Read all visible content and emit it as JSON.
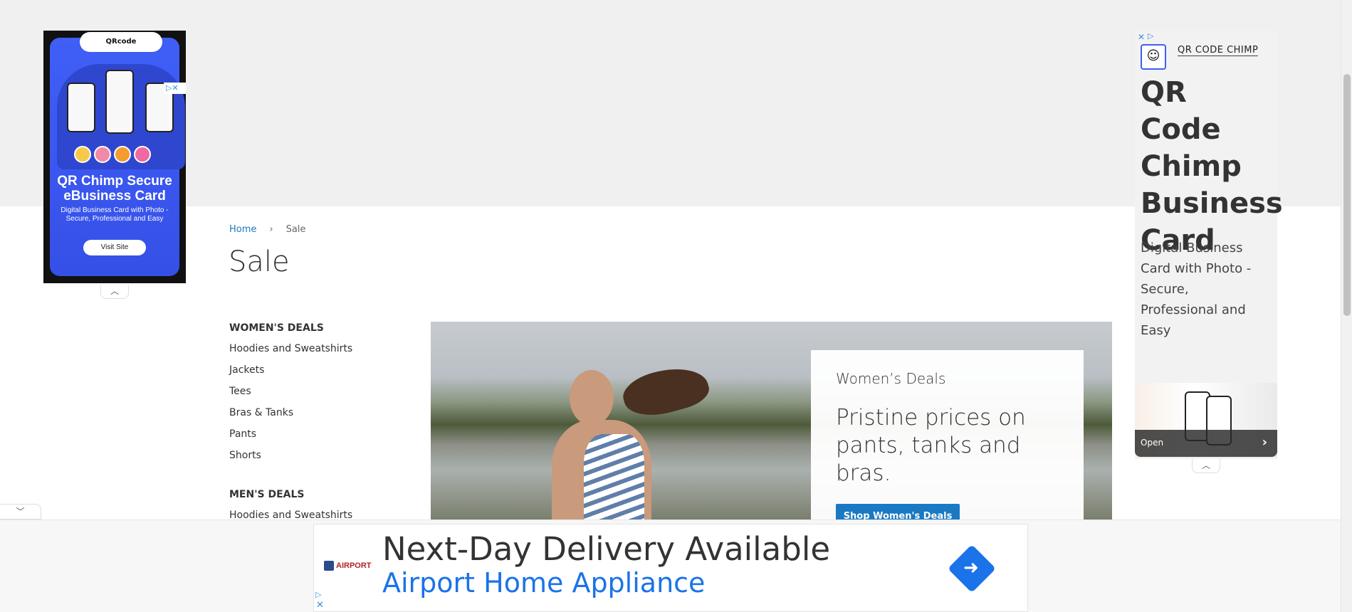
{
  "left_ad": {
    "brand_logo": "QRcode",
    "headline": "QR Chimp Secure eBusiness Card",
    "subtext": "Digital Business Card with Photo - Secure, Professional and Easy",
    "button": "Visit Site",
    "adchoices_icon": "adchoices-icon",
    "collapse_icon": "chevron-up-icon"
  },
  "right_ad": {
    "brand": "QR CODE CHIMP",
    "title": "QR Code Chimp Business Card",
    "description": "Digital Business Card with Photo - Secure, Professional and Easy",
    "open_label": "Open",
    "collapse_icon": "chevron-up-icon"
  },
  "breadcrumb": {
    "home": "Home",
    "separator": "›",
    "current": "Sale"
  },
  "page_title": "Sale",
  "sidebar": {
    "sections": [
      {
        "title": "WOMEN'S DEALS",
        "items": [
          "Hoodies and Sweatshirts",
          "Jackets",
          "Tees",
          "Bras & Tanks",
          "Pants",
          "Shorts"
        ]
      },
      {
        "title": "MEN'S DEALS",
        "items": [
          "Hoodies and Sweatshirts"
        ]
      }
    ]
  },
  "hero": {
    "kicker": "Women’s Deals",
    "heading": "Pristine prices on pants, tanks and bras.",
    "button": "Shop Women's Deals"
  },
  "bottom_ad": {
    "logo": "AIRPORT",
    "headline": "Next-Day Delivery Available",
    "advertiser": "Airport Home Appliance"
  },
  "colors": {
    "link_blue": "#1979c3",
    "ad_blue": "#1a73e8",
    "left_ad_blue": "#3f5ff6"
  }
}
